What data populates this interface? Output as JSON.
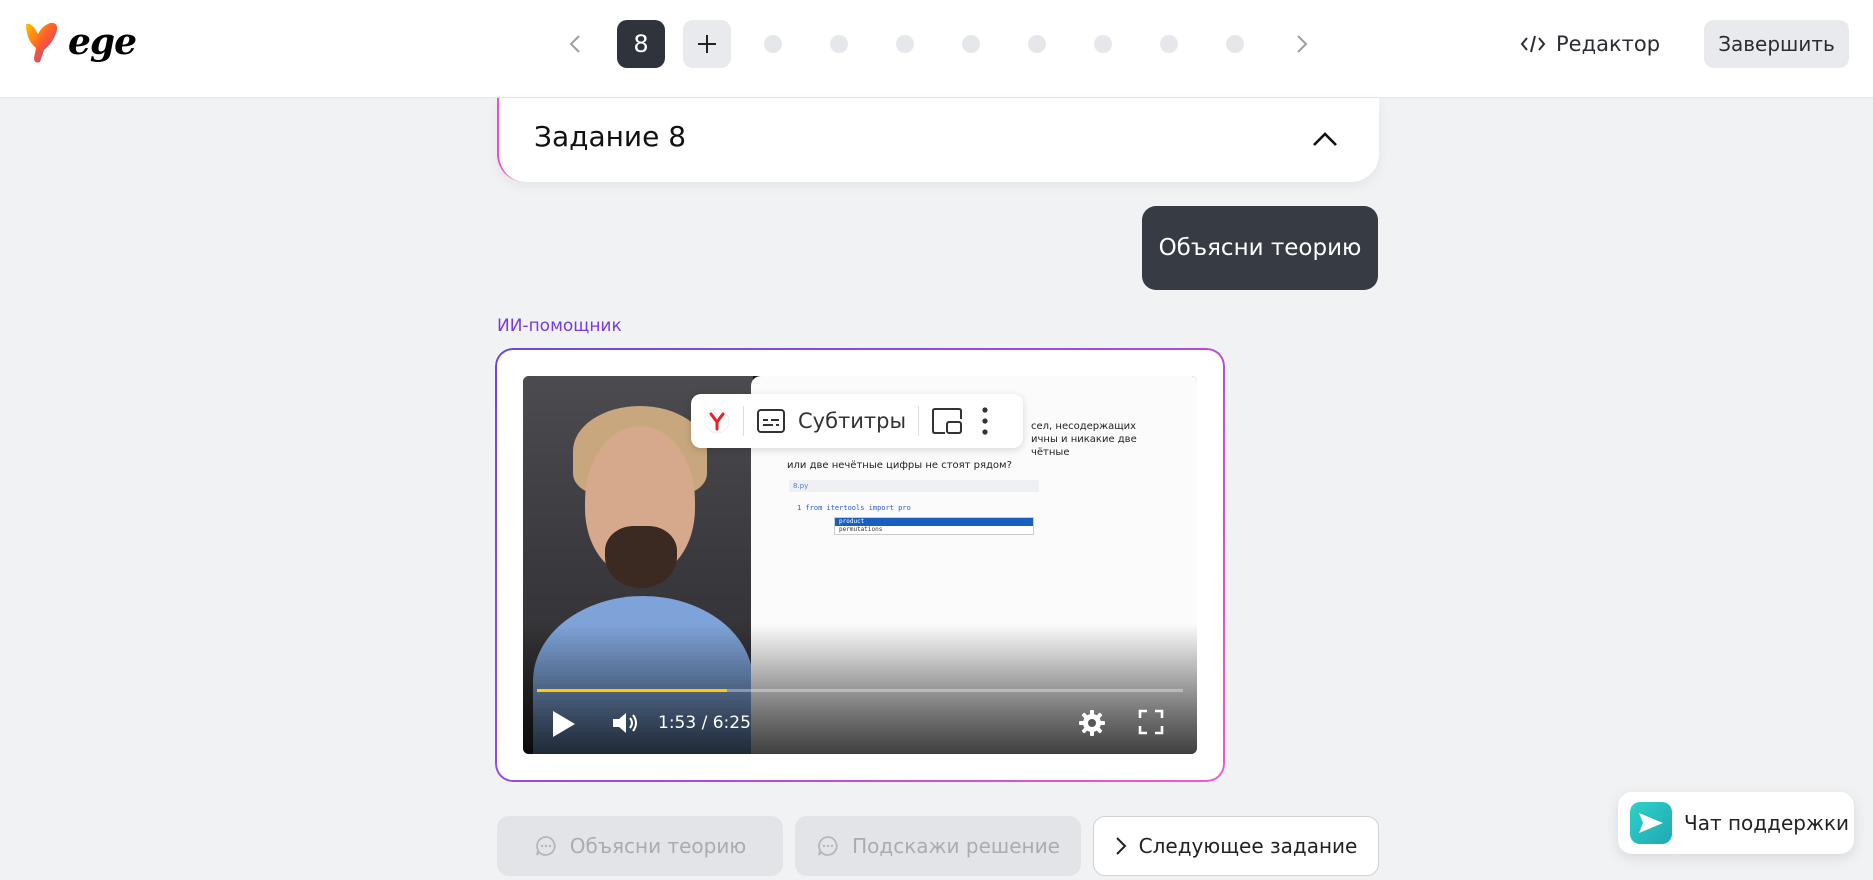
{
  "header": {
    "logo_text": "ege",
    "nav": {
      "prev_icon": "chevron-left-icon",
      "current_task": "8",
      "add_icon": "plus-icon",
      "dot_count": 8,
      "next_icon": "chevron-right-icon"
    },
    "editor_label": "Редактор",
    "finish_label": "Завершить"
  },
  "task": {
    "title": "Задание 8",
    "toggle_icon": "chevron-up-icon"
  },
  "chat": {
    "user_message": "Объясни теорию",
    "assistant_label": "ИИ-помощник"
  },
  "video": {
    "screen_text_lines": [
      "сел, несодержащих",
      "ичны и никакие две чётные",
      "или две нечётные цифры не стоят рядом?"
    ],
    "code_tab": "8.py",
    "code_line": "1  from itertools import pro",
    "autocomplete": [
      "product",
      "permutations"
    ],
    "subtitles_label": "Субтитры",
    "time": "1:53 / 6:25",
    "progress_fraction": 0.294,
    "accent_color": "#ffcc00"
  },
  "actions": {
    "theory": "Объясни теорию",
    "hint": "Подскажи решение",
    "next": "Следующее задание"
  },
  "support": {
    "label": "Чат поддержки"
  },
  "colors": {
    "assistant_accent": "#7a3bdb",
    "dark_button": "#2f333b",
    "user_bubble": "#363b44"
  }
}
